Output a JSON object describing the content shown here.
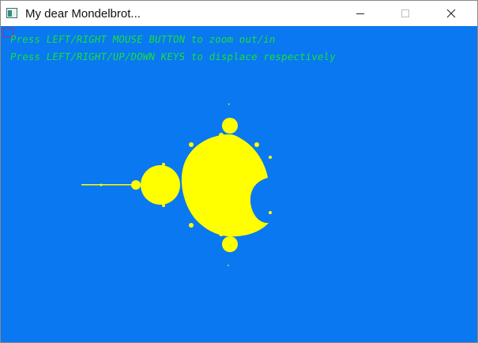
{
  "window": {
    "title": "My dear Mondelbrot...",
    "icon": "console-app-icon",
    "controls": [
      "minimize-icon",
      "maximize-icon",
      "close-icon"
    ]
  },
  "canvas": {
    "background_color": "#0a78f0",
    "fractal_color": "#ffff00",
    "text_color": "#19e03c",
    "instructions": [
      "Press LEFT/RIGHT MOUSE BUTTON to zoom out/in",
      "Press LEFT/RIGHT/UP/DOWN KEYS to displace respectively"
    ]
  }
}
